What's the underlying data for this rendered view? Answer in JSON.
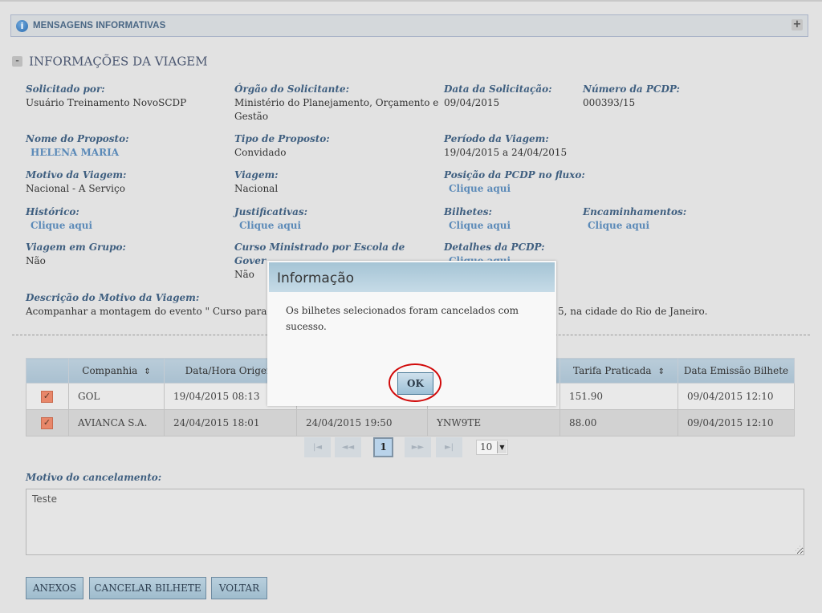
{
  "messages_bar": {
    "title": "MENSAGENS INFORMATIVAS",
    "info_icon": "i",
    "expand_icon": "+"
  },
  "section": {
    "collapse_icon": "-",
    "title": "INFORMAÇÕES DA VIAGEM"
  },
  "fields": {
    "solicitado_por": {
      "label": "Solicitado por:",
      "value": "Usuário Treinamento NovoSCDP"
    },
    "orgao": {
      "label": "Órgão do Solicitante:",
      "value": "Ministério do Planejamento, Orçamento e",
      "value2": "Gestão"
    },
    "data_solicitacao": {
      "label": "Data da Solicitação:",
      "value": "09/04/2015"
    },
    "numero_pcdp": {
      "label": "Número da PCDP:",
      "value": "000393/15"
    },
    "nome_proposto": {
      "label": "Nome do Proposto:",
      "value": "HELENA MARIA"
    },
    "tipo_proposto": {
      "label": "Tipo de Proposto:",
      "value": "Convidado"
    },
    "periodo": {
      "label": "Período da Viagem:",
      "value": "19/04/2015 a 24/04/2015"
    },
    "motivo": {
      "label": "Motivo da Viagem:",
      "value": "Nacional - A Serviço"
    },
    "viagem": {
      "label": "Viagem:",
      "value": "Nacional"
    },
    "posicao": {
      "label": "Posição da PCDP no fluxo:",
      "link": "Clique aqui"
    },
    "historico": {
      "label": "Histórico:",
      "link": "Clique aqui"
    },
    "justificativas": {
      "label": "Justificativas:",
      "link": "Clique aqui"
    },
    "bilhetes": {
      "label": "Bilhetes:",
      "link": "Clique aqui"
    },
    "encaminhamentos": {
      "label": "Encaminhamentos:",
      "link": "Clique aqui"
    },
    "viagem_grupo": {
      "label": "Viagem em Grupo:",
      "value": "Não"
    },
    "curso": {
      "label": "Curso Ministrado por Escola de",
      "label2": "Gover",
      "value": "Não"
    },
    "detalhes": {
      "label": "Detalhes da PCDP:",
      "link": "Clique aqui"
    },
    "descricao": {
      "label": "Descrição do Motivo da Viagem:",
      "value_left": "Acompanhar a montagem do evento \" Curso para Di",
      "value_right": "5, na cidade do Rio de Janeiro."
    }
  },
  "table": {
    "headers": [
      "",
      "Companhia",
      "Data/Hora Origem",
      "",
      "",
      "Tarifa Praticada",
      "Data Emissão Bilhete"
    ],
    "sort_icon": "⇕",
    "rows": [
      {
        "checked": true,
        "companhia": "GOL",
        "origem": "19/04/2015 08:13",
        "destino": "",
        "localizador": "",
        "tarifa": "151.90",
        "emissao": "09/04/2015 12:10"
      },
      {
        "checked": true,
        "companhia": "AVIANCA S.A.",
        "origem": "24/04/2015 18:01",
        "destino": "24/04/2015 19:50",
        "localizador": "YNW9TE",
        "tarifa": "88.00",
        "emissao": "09/04/2015 12:10"
      }
    ]
  },
  "pager": {
    "first": "|◄",
    "prev": "◄◄",
    "current": "1",
    "next": "►►",
    "last": "►|",
    "page_size": "10"
  },
  "cancel_reason": {
    "label": "Motivo do cancelamento:",
    "value": "Teste"
  },
  "buttons": {
    "anexos": "ANEXOS",
    "cancelar": "CANCELAR BILHETE",
    "voltar": "VOLTAR"
  },
  "modal": {
    "title": "Informação",
    "message": "Os bilhetes selecionados foram cancelados com sucesso.",
    "ok": "OK"
  }
}
